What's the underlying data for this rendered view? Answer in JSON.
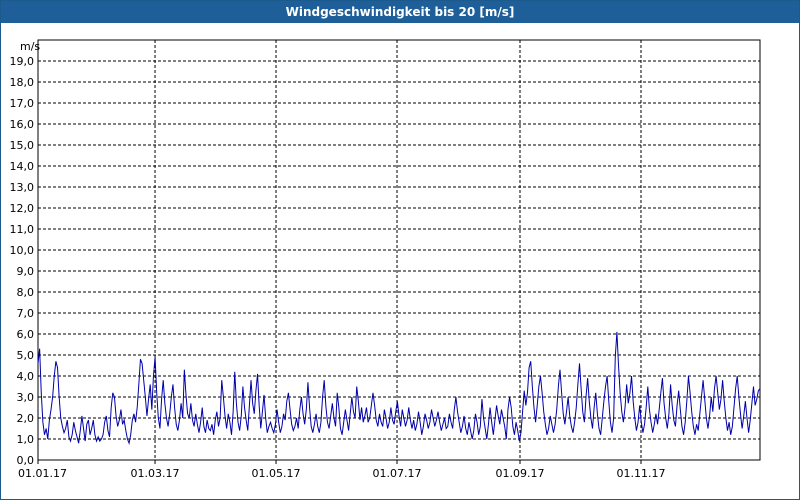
{
  "window": {
    "title": "Windgeschwindigkeit bis 20 [m/s]"
  },
  "colors": {
    "title_bar": "#1f5f99",
    "series": "#0000aa",
    "grid": "#000000"
  },
  "chart_data": {
    "type": "line",
    "title": "Windgeschwindigkeit bis 20 [m/s]",
    "ylabel": "m/s",
    "xlabel": "",
    "ylim": [
      0,
      20
    ],
    "xlim": [
      0,
      364
    ],
    "grid": true,
    "y_ticks": [
      "0,0",
      "1,0",
      "2,0",
      "3,0",
      "4,0",
      "5,0",
      "6,0",
      "7,0",
      "8,0",
      "9,0",
      "10,0",
      "11,0",
      "12,0",
      "13,0",
      "14,0",
      "15,0",
      "16,0",
      "17,0",
      "18,0",
      "19,0"
    ],
    "y_tick_values": [
      0,
      1,
      2,
      3,
      4,
      5,
      6,
      7,
      8,
      9,
      10,
      11,
      12,
      13,
      14,
      15,
      16,
      17,
      18,
      19
    ],
    "x_ticks": [
      {
        "label": "01.01.17",
        "day": 0
      },
      {
        "label": "01.03.17",
        "day": 59
      },
      {
        "label": "01.05.17",
        "day": 120
      },
      {
        "label": "01.07.17",
        "day": 181
      },
      {
        "label": "01.09.17",
        "day": 243
      },
      {
        "label": "01.11.17",
        "day": 304
      }
    ],
    "series": [
      {
        "values": [
          4.6,
          5.3,
          3.2,
          1.8,
          1.2,
          1.5,
          1.0,
          1.9,
          2.4,
          3.0,
          4.0,
          4.7,
          4.4,
          3.0,
          2.0,
          1.6,
          1.3,
          1.5,
          1.9,
          1.1,
          0.9,
          1.2,
          1.8,
          1.4,
          1.1,
          0.8,
          1.4,
          2.1,
          1.5,
          0.9,
          1.7,
          1.9,
          1.2,
          1.5,
          1.9,
          1.2,
          0.9,
          1.1,
          0.9,
          1.0,
          1.2,
          1.8,
          2.1,
          1.4,
          1.1,
          2.5,
          3.2,
          3.0,
          2.1,
          1.6,
          1.9,
          2.4,
          1.7,
          1.9,
          1.4,
          1.0,
          0.8,
          1.2,
          1.9,
          2.2,
          1.8,
          2.5,
          3.6,
          4.8,
          4.6,
          3.8,
          3.0,
          2.1,
          2.9,
          3.6,
          2.4,
          4.0,
          4.9,
          3.2,
          2.0,
          1.5,
          2.9,
          3.8,
          2.7,
          2.0,
          1.6,
          2.2,
          3.0,
          3.6,
          2.5,
          1.7,
          1.4,
          1.9,
          2.7,
          2.0,
          4.3,
          3.1,
          2.2,
          2.0,
          2.7,
          1.9,
          1.6,
          2.2,
          1.7,
          1.3,
          1.8,
          2.5,
          1.6,
          1.3,
          1.9,
          1.5,
          1.4,
          1.7,
          1.2,
          1.9,
          2.3,
          1.6,
          2.0,
          3.8,
          3.0,
          2.1,
          1.5,
          2.2,
          1.8,
          1.2,
          2.3,
          4.2,
          2.7,
          1.8,
          1.4,
          2.1,
          3.5,
          2.5,
          1.9,
          1.4,
          2.6,
          3.8,
          2.7,
          2.2,
          3.3,
          4.1,
          2.6,
          1.5,
          2.3,
          3.1,
          2.0,
          1.3,
          1.6,
          1.8,
          1.5,
          1.3,
          1.7,
          2.4,
          1.8,
          1.3,
          1.6,
          2.2,
          1.9,
          2.8,
          3.2,
          2.4,
          1.7,
          1.4,
          1.6,
          2.0,
          1.5,
          2.4,
          3.0,
          2.2,
          1.7,
          2.4,
          3.7,
          2.5,
          1.6,
          1.3,
          1.7,
          2.2,
          1.6,
          1.3,
          1.8,
          3.0,
          3.8,
          2.6,
          1.8,
          1.5,
          2.1,
          2.7,
          2.0,
          1.6,
          3.2,
          2.5,
          1.5,
          1.2,
          1.8,
          2.4,
          1.9,
          1.4,
          2.2,
          3.0,
          2.3,
          2.0,
          3.5,
          2.8,
          1.9,
          2.5,
          1.8,
          2.1,
          2.5,
          1.8,
          2.0,
          2.6,
          3.2,
          2.6,
          1.9,
          1.6,
          2.2,
          1.8,
          1.6,
          2.4,
          2.0,
          1.5,
          1.8,
          2.5,
          1.9,
          1.7,
          2.3,
          2.8,
          2.1,
          1.6,
          2.4,
          2.0,
          1.6,
          1.9,
          2.5,
          1.9,
          1.5,
          1.9,
          1.4,
          1.7,
          2.3,
          1.8,
          1.2,
          1.6,
          2.2,
          1.9,
          1.5,
          1.8,
          2.4,
          2.0,
          1.6,
          1.9,
          2.3,
          1.8,
          1.4,
          1.7,
          2.0,
          1.5,
          1.6,
          2.2,
          1.8,
          1.5,
          2.4,
          3.0,
          2.3,
          1.8,
          1.3,
          1.6,
          2.1,
          1.5,
          1.2,
          1.8,
          1.4,
          1.0,
          1.4,
          2.2,
          1.8,
          1.2,
          1.6,
          2.9,
          2.0,
          1.5,
          1.0,
          1.7,
          2.5,
          1.8,
          1.2,
          1.9,
          2.6,
          2.1,
          1.7,
          2.4,
          2.0,
          1.6,
          1.0,
          2.4,
          3.0,
          2.5,
          1.6,
          1.2,
          1.8,
          1.4,
          0.9,
          1.3,
          2.3,
          3.3,
          2.6,
          3.2,
          4.4,
          4.7,
          3.5,
          2.5,
          1.8,
          2.6,
          3.5,
          4.0,
          3.2,
          2.3,
          1.7,
          1.2,
          1.5,
          2.1,
          1.7,
          1.3,
          1.7,
          2.4,
          3.5,
          4.3,
          3.2,
          2.2,
          1.7,
          2.3,
          3.0,
          2.1,
          1.6,
          1.3,
          1.8,
          2.5,
          3.6,
          4.6,
          3.4,
          2.3,
          1.8,
          3.0,
          3.9,
          2.8,
          2.0,
          1.5,
          2.5,
          3.2,
          2.2,
          1.5,
          1.2,
          2.0,
          2.8,
          3.5,
          4.0,
          2.8,
          1.8,
          1.3,
          2.0,
          4.9,
          6.1,
          4.5,
          3.2,
          2.3,
          1.8,
          2.5,
          3.6,
          2.7,
          3.2,
          4.0,
          2.8,
          2.0,
          1.4,
          1.8,
          2.6,
          1.8,
          1.3,
          1.7,
          2.5,
          3.5,
          2.4,
          1.8,
          1.3,
          1.7,
          2.2,
          1.7,
          2.4,
          3.2,
          3.9,
          2.7,
          2.0,
          1.5,
          2.2,
          3.6,
          2.6,
          1.9,
          1.6,
          2.6,
          3.3,
          2.4,
          1.6,
          1.2,
          1.8,
          2.8,
          4.0,
          3.2,
          2.3,
          1.6,
          1.2,
          1.7,
          1.4,
          2.2,
          3.0,
          3.8,
          2.9,
          2.0,
          1.5,
          2.1,
          3.0,
          2.3,
          3.4,
          4.0,
          3.2,
          2.4,
          2.9,
          3.8,
          2.8,
          2.0,
          1.4,
          1.8,
          1.2,
          1.6,
          2.5,
          3.4,
          4.0,
          3.0,
          2.2,
          1.5,
          2.1,
          2.8,
          2.0,
          1.3,
          1.9,
          2.7,
          3.5,
          2.6,
          2.9,
          3.3,
          3.4
        ]
      }
    ]
  }
}
